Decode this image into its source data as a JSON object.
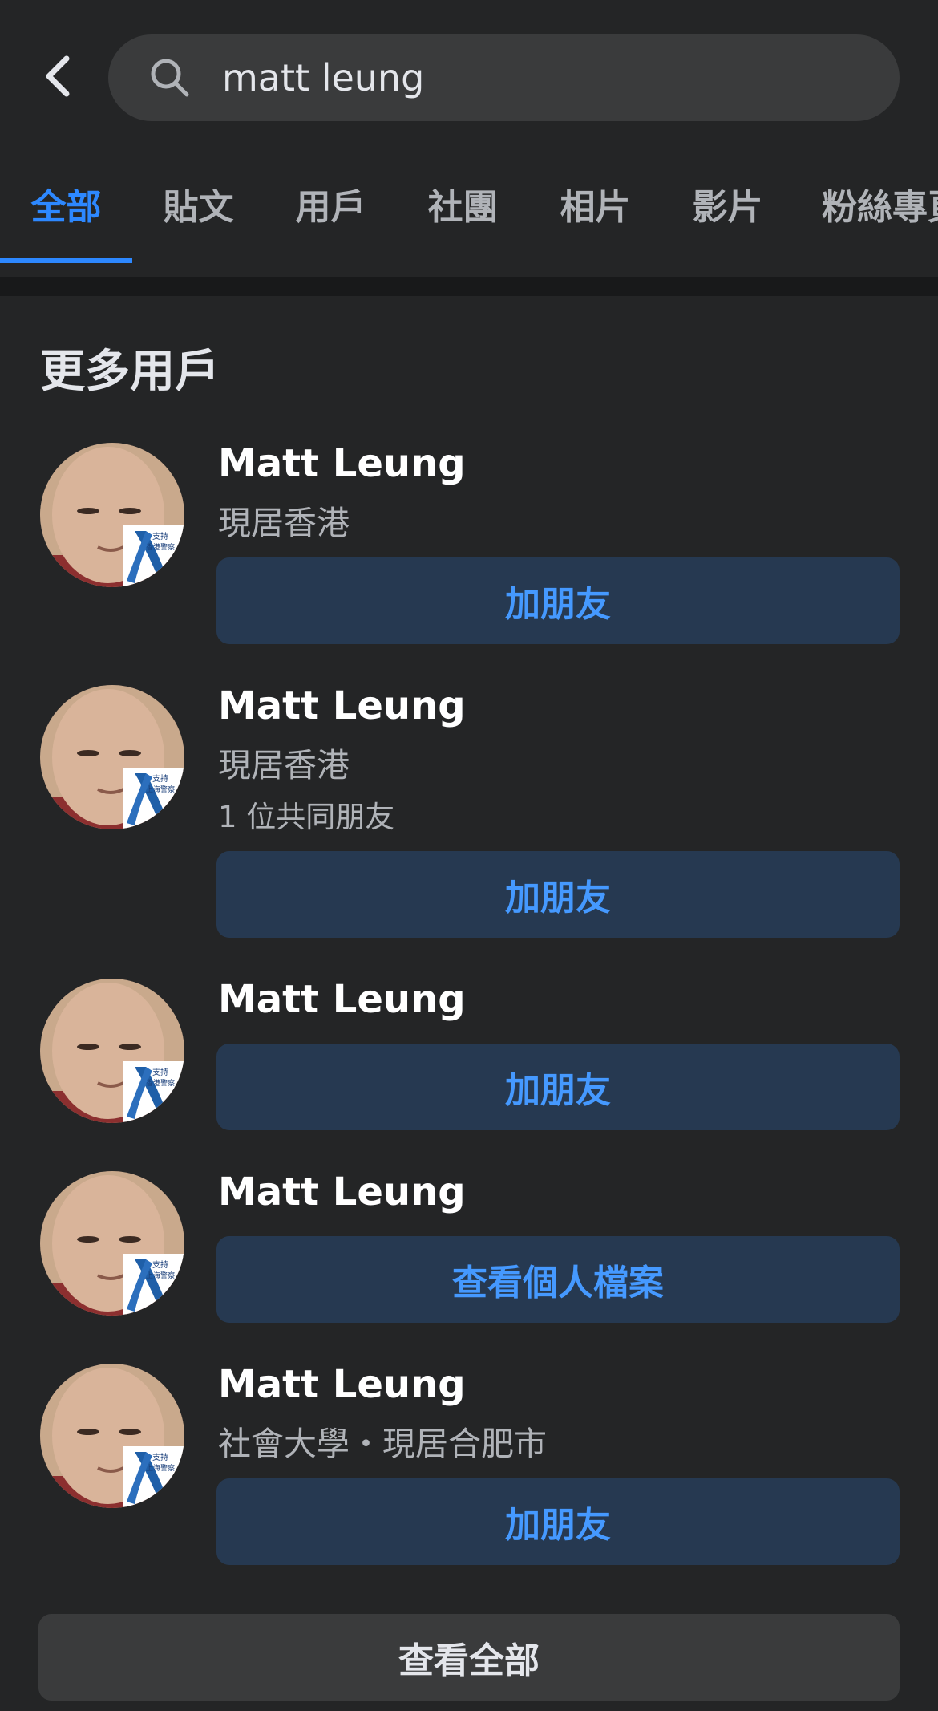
{
  "search": {
    "query": "matt leung",
    "icon": "search-icon"
  },
  "tabs": [
    {
      "label": "全部",
      "active": true
    },
    {
      "label": "貼文"
    },
    {
      "label": "用戶"
    },
    {
      "label": "社團"
    },
    {
      "label": "相片"
    },
    {
      "label": "影片"
    },
    {
      "label": "粉絲專頁"
    }
  ],
  "section": {
    "title": "更多用戶"
  },
  "people": [
    {
      "name": "Matt Leung",
      "lines": [
        "現居香港"
      ],
      "action": "加朋友",
      "ribbon_text": [
        "支持",
        "香港警察"
      ]
    },
    {
      "name": "Matt Leung",
      "lines": [
        "現居香港",
        "1 位共同朋友"
      ],
      "action": "加朋友",
      "ribbon_text": [
        "支持",
        "上海警察"
      ]
    },
    {
      "name": "Matt Leung",
      "lines": [],
      "action": "加朋友",
      "ribbon_text": [
        "支持",
        "香港警察"
      ]
    },
    {
      "name": "Matt Leung",
      "lines": [],
      "action": "查看個人檔案",
      "ribbon_text": [
        "支持",
        "上海警察"
      ]
    },
    {
      "name": "Matt Leung",
      "lines": [
        "社會大學・現居合肥市"
      ],
      "action": "加朋友",
      "ribbon_text": [
        "支持",
        "上海警察"
      ]
    }
  ],
  "see_all": "查看全部",
  "colors": {
    "accent": "#2d88ff",
    "button_bg": "#263951",
    "button_text": "#4599ff",
    "background": "#242526"
  }
}
